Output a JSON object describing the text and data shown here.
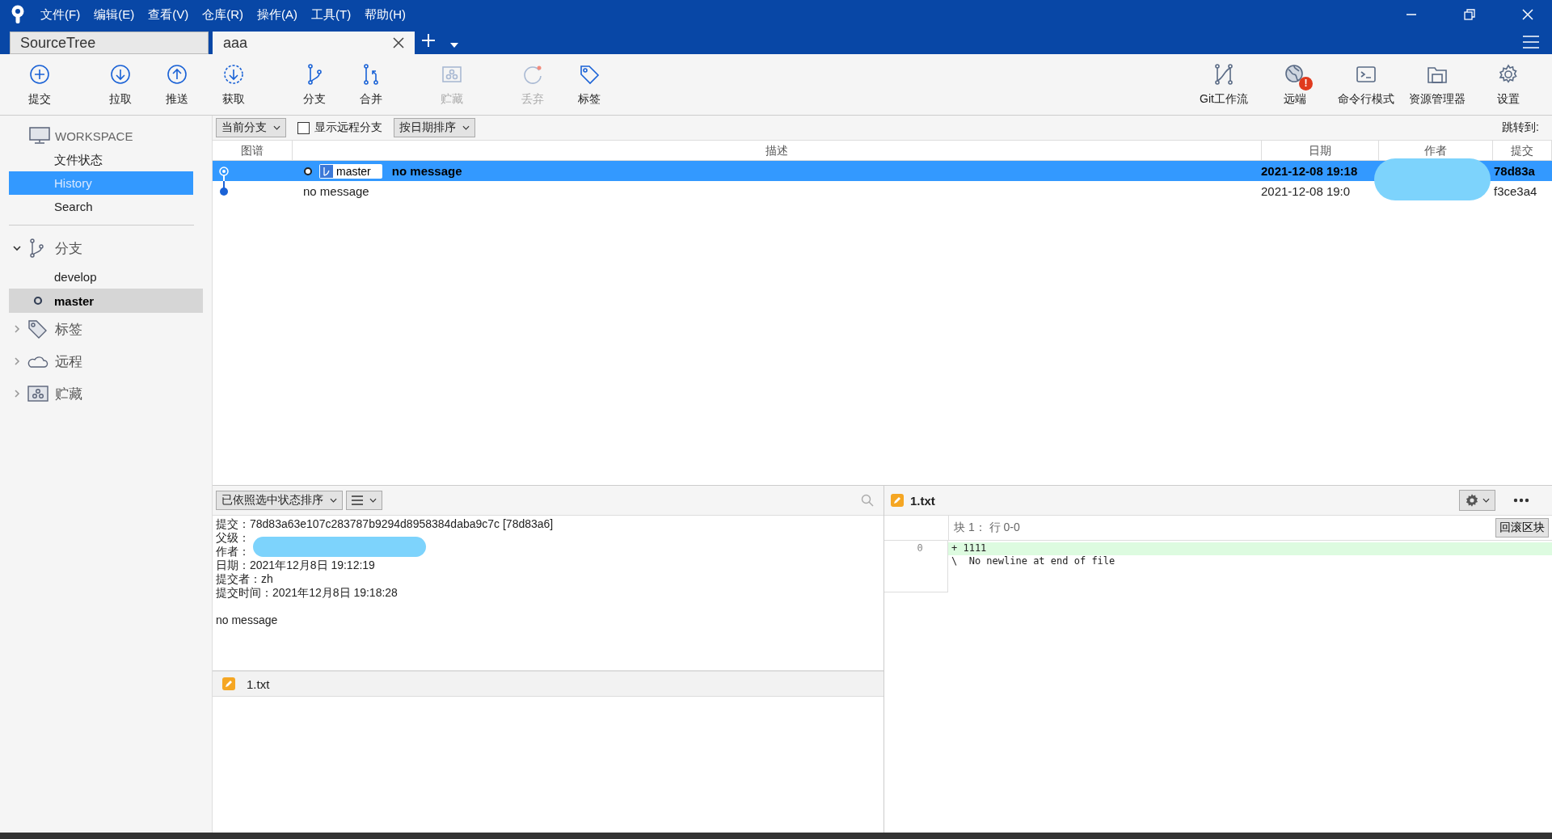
{
  "menu": [
    "文件(F)",
    "编辑(E)",
    "查看(V)",
    "仓库(R)",
    "操作(A)",
    "工具(T)",
    "帮助(H)"
  ],
  "tabs": [
    {
      "label": "SourceTree",
      "selected": false,
      "closable": false
    },
    {
      "label": "aaa",
      "selected": true,
      "closable": true
    }
  ],
  "toolbar": {
    "left": [
      {
        "label": "提交",
        "kind": "commit",
        "disabled": false
      },
      {
        "label": "拉取",
        "kind": "pull",
        "disabled": false
      },
      {
        "label": "推送",
        "kind": "push",
        "disabled": false
      },
      {
        "label": "获取",
        "kind": "fetch",
        "disabled": false
      },
      {
        "label": "分支",
        "kind": "branch",
        "disabled": false
      },
      {
        "label": "合并",
        "kind": "merge",
        "disabled": false
      },
      {
        "label": "贮藏",
        "kind": "stash",
        "disabled": true
      },
      {
        "label": "丢弃",
        "kind": "discard",
        "disabled": true
      },
      {
        "label": "标签",
        "kind": "tag",
        "disabled": false
      }
    ],
    "right": [
      {
        "label": "Git工作流",
        "kind": "gitflow",
        "disabled": false
      },
      {
        "label": "远端",
        "kind": "remote",
        "disabled": false,
        "badge": "!"
      },
      {
        "label": "命令行模式",
        "kind": "terminal",
        "disabled": false
      },
      {
        "label": "资源管理器",
        "kind": "explorer",
        "disabled": false
      },
      {
        "label": "设置",
        "kind": "settings",
        "disabled": false
      }
    ]
  },
  "sidebar": {
    "workspace": {
      "title": "WORKSPACE",
      "items": [
        {
          "label": "文件状态",
          "selected": false
        },
        {
          "label": "History",
          "selected": true
        },
        {
          "label": "Search",
          "selected": false
        }
      ]
    },
    "sections": [
      {
        "label": "分支",
        "kind": "branch",
        "expanded": true,
        "children": [
          {
            "label": "develop",
            "current": false
          },
          {
            "label": "master",
            "current": true
          }
        ]
      },
      {
        "label": "标签",
        "kind": "tag",
        "expanded": false
      },
      {
        "label": "远程",
        "kind": "cloud",
        "expanded": false
      },
      {
        "label": "贮藏",
        "kind": "stash",
        "expanded": false
      }
    ]
  },
  "history": {
    "branch_filter": "当前分支",
    "show_remote": {
      "label": "显示远程分支",
      "checked": false
    },
    "sort": "按日期排序",
    "jump_label": "跳转到:",
    "columns": [
      "图谱",
      "描述",
      "日期",
      "作者",
      "提交"
    ],
    "rows": [
      {
        "selected": true,
        "branch_label": "master",
        "description": "no message",
        "date": "2021-12-08 19:18",
        "commit": "78d83a"
      },
      {
        "selected": false,
        "description": "no message",
        "date": "2021-12-08 19:0",
        "commit": "f3ce3a4"
      }
    ]
  },
  "details": {
    "sort": "已依照选中状态排序",
    "lines": [
      {
        "label": "提交：",
        "value": "78d83a63e107c283787b9294d8958384daba9c7c [78d83a6]"
      },
      {
        "label": "父级："
      },
      {
        "label": "作者："
      },
      {
        "label": "日期：",
        "value": "2021年12月8日 19:12:19"
      },
      {
        "label": "提交者：",
        "value": "zh"
      },
      {
        "label": "提交时间：",
        "value": "2021年12月8日 19:18:28"
      }
    ],
    "message": "no message",
    "files": [
      {
        "name": "1.txt"
      }
    ]
  },
  "diff": {
    "file": "1.txt",
    "hunk": "块 1： 行 0-0",
    "revert": "回滚区块",
    "lines": [
      {
        "number": "0",
        "text": "+ 1111",
        "kind": "added"
      },
      {
        "text": "\\  No newline at end of file",
        "kind": "context"
      }
    ]
  }
}
